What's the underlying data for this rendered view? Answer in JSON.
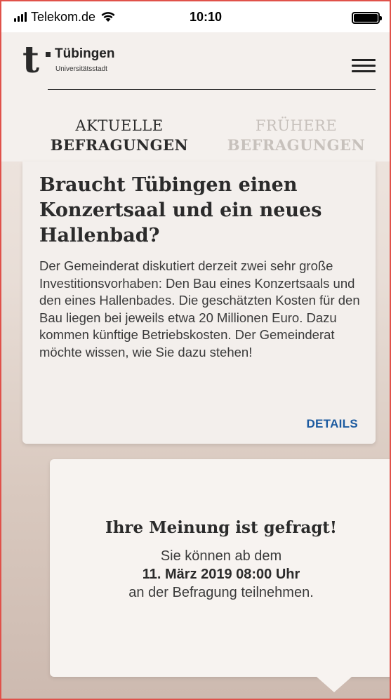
{
  "status_bar": {
    "carrier": "Telekom.de",
    "time": "10:10",
    "icons": [
      "signal-icon",
      "wifi-icon",
      "battery-icon"
    ]
  },
  "header": {
    "logo_letter": "t",
    "city_name": "Tübingen",
    "city_subtitle": "Universitätsstadt",
    "menu_icon": "hamburger-menu-icon"
  },
  "tabs": [
    {
      "line1": "AKTUELLE",
      "line2": "BEFRAGUNGEN",
      "active": true
    },
    {
      "line1": "FRÜHERE",
      "line2": "BEFRAGUNGEN",
      "active": false
    }
  ],
  "survey_card": {
    "title": "Braucht Tübingen einen Konzertsaal und ein neues Hallenbad?",
    "description": "Der Gemeinderat diskutiert derzeit zwei sehr große Investitionsvorhaben: Den Bau eines Konzertsaals und den eines Hallenbades. Die geschätzten Kosten für den Bau liegen bei jeweils etwa 20 Millionen Euro. Dazu kommen künftige Betriebskosten. Der Gemeinderat möchte wissen, wie Sie dazu stehen!",
    "details_label": "DETAILS"
  },
  "info_card": {
    "title": "Ihre Meinung ist gefragt!",
    "line1": "Sie können ab dem",
    "date": "11. März 2019 08:00 Uhr",
    "line3": "an der Befragung teilnehmen."
  },
  "colors": {
    "link_blue": "#1b5aa0",
    "inactive_tab": "#c7c1bc",
    "text_dark": "#2b2b2b"
  }
}
